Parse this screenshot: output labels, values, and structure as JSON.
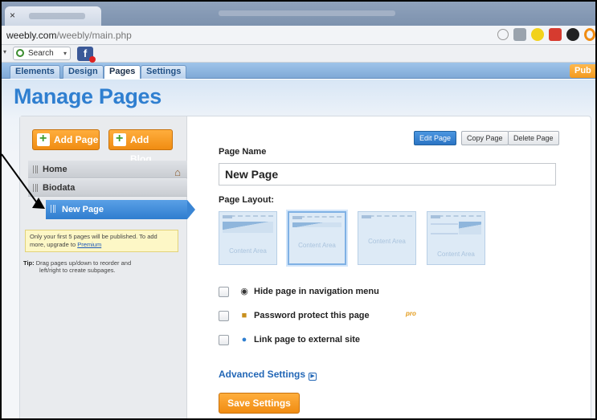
{
  "browser": {
    "tab_close": "×",
    "url_host": "weebly.com",
    "url_path": "/weebly/main.php",
    "toolbar_search_label": "Search",
    "toolbar_search_chevron": "▾",
    "toolbar_left_chevron": "▾",
    "facebook_letter": "f"
  },
  "nav": {
    "tabs": [
      {
        "label": "Elements"
      },
      {
        "label": "Design"
      },
      {
        "label": "Pages"
      },
      {
        "label": "Settings"
      }
    ],
    "active_tab": "Pages",
    "publish_label": "Pub"
  },
  "page_title": "Manage Pages",
  "sidebar": {
    "add_page_label": "Add Page",
    "add_blog_label": "Add Blog",
    "pages": [
      {
        "label": "Home"
      },
      {
        "label": "Biodata"
      },
      {
        "label": "New Page"
      }
    ],
    "notice_text": "Only your first 5 pages will be published. To add more, upgrade to ",
    "notice_link": "Premium",
    "tip_label": "Tip:",
    "tip_line1": "Drag pages up/down to reorder and",
    "tip_line2": "left/right to create subpages."
  },
  "actions": {
    "edit_page": "Edit Page",
    "copy_page": "Copy Page",
    "delete_page": "Delete Page"
  },
  "form": {
    "page_name_label": "Page Name",
    "page_name_value": "New Page",
    "page_layout_label": "Page Layout:",
    "layouts": [
      {
        "text": "Content Area"
      },
      {
        "text": "Content Area"
      },
      {
        "text": "Content Area"
      },
      {
        "text": "Content Area"
      }
    ],
    "options": [
      {
        "label": "Hide page in navigation menu",
        "icon": "eye-icon"
      },
      {
        "label": "Password protect this page",
        "icon": "lock-icon"
      },
      {
        "label": "Link page to external site",
        "icon": "globe-icon"
      }
    ],
    "pro_badge": "pro",
    "advanced_settings_label": "Advanced Settings",
    "advanced_settings_arrow": "▶",
    "save_label": "Save Settings"
  },
  "colors": {
    "accent_blue": "#2f7fd0",
    "orange": "#f08c12",
    "selected_row": "#3a85d4"
  }
}
